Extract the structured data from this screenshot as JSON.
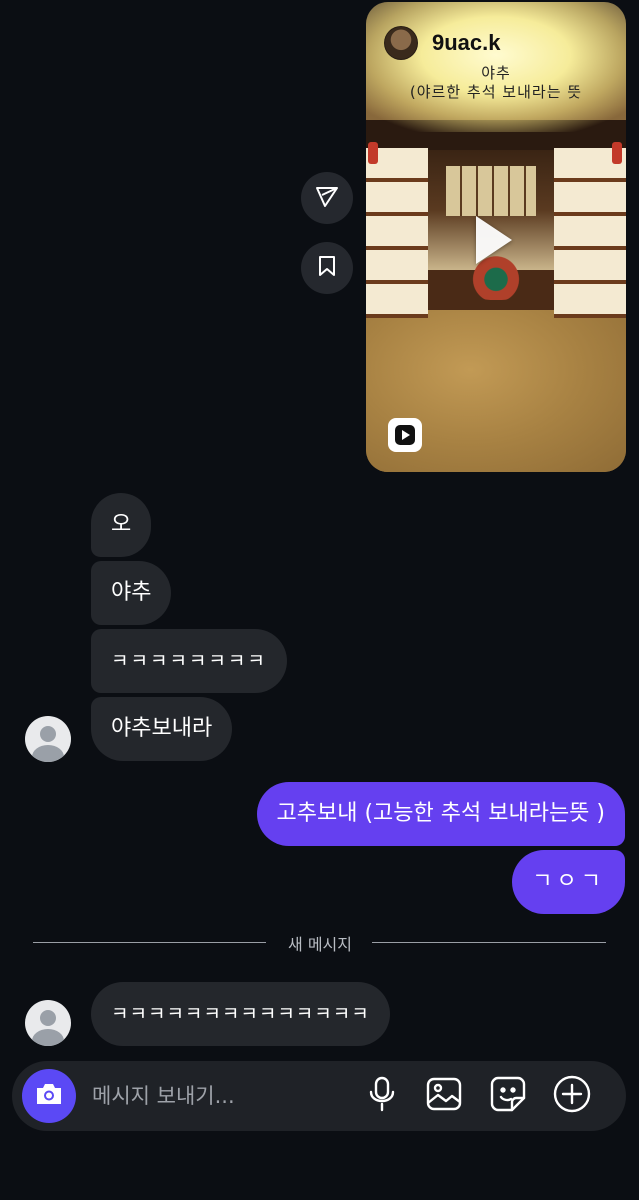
{
  "reel": {
    "username": "9uac.k",
    "caption_line1": "야추",
    "caption_line2": "(야르한 추석 보내라는 뜻"
  },
  "messages": {
    "incoming_1": [
      "오",
      "야추",
      "ㅋㅋㅋㅋㅋㅋㅋㅋ",
      "야추보내라"
    ],
    "outgoing": [
      "고추보내 (고능한 추석 보내라는뜻 )",
      "ㄱㅇㄱ"
    ],
    "incoming_2": [
      "ㅋㅋㅋㅋㅋㅋㅋㅋㅋㅋㅋㅋㅋㅋ"
    ]
  },
  "divider": {
    "label": "새 메시지"
  },
  "composer": {
    "placeholder": "메시지 보내기..."
  },
  "colors": {
    "background": "#0b0e13",
    "incoming_bubble": "#24272c",
    "outgoing_bubble": "#6540f0",
    "camera_button": "#5b49f5"
  },
  "icons": {
    "share": "send-icon",
    "save": "bookmark-icon",
    "camera": "camera-icon",
    "mic": "microphone-icon",
    "gallery": "gallery-icon",
    "sticker": "sticker-icon",
    "more": "plus-icon"
  }
}
